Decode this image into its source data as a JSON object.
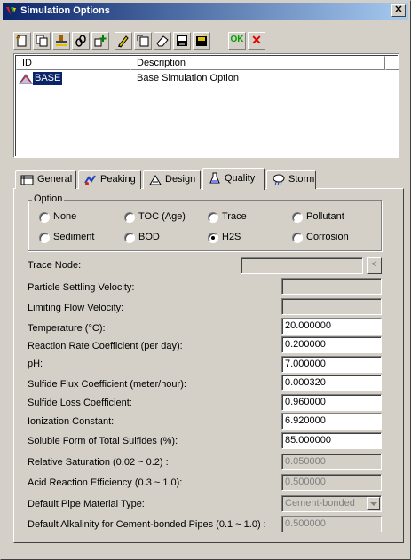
{
  "window": {
    "title": "Simulation Options",
    "close_glyph": "✕"
  },
  "toolbar": {
    "buttons": [
      {
        "name": "new-icon"
      },
      {
        "name": "copy-icon"
      },
      {
        "name": "stamp-icon"
      },
      {
        "name": "link-icon"
      },
      {
        "name": "add-icon"
      },
      {
        "name": "edit-icon"
      },
      {
        "name": "rename-icon"
      },
      {
        "name": "eraser-icon"
      },
      {
        "name": "save-icon"
      },
      {
        "name": "save-all-icon"
      }
    ],
    "ok_label": "OK",
    "cancel_glyph": "✕"
  },
  "list": {
    "columns": [
      "ID",
      "Description"
    ],
    "rows": [
      {
        "id": "BASE",
        "description": "Base Simulation Option"
      }
    ]
  },
  "tabs": [
    {
      "label": "General",
      "icon": "book-icon"
    },
    {
      "label": "Peaking",
      "icon": "peaking-icon"
    },
    {
      "label": "Design",
      "icon": "design-icon"
    },
    {
      "label": "Quality",
      "icon": "flask-icon"
    },
    {
      "label": "Storm",
      "icon": "storm-icon"
    }
  ],
  "active_tab": "Quality",
  "option": {
    "title": "Option",
    "choices": [
      "None",
      "TOC (Age)",
      "Trace",
      "Pollutant",
      "Sediment",
      "BOD",
      "H2S",
      "Corrosion"
    ],
    "selected": "H2S"
  },
  "fields": {
    "trace_node": {
      "label": "Trace Node:",
      "value": "",
      "browse": "<"
    },
    "settling_velocity": {
      "label": "Particle Settling Velocity:",
      "value": ""
    },
    "limiting_flow": {
      "label": "Limiting Flow Velocity:",
      "value": ""
    },
    "temperature": {
      "label": "Temperature (°C):",
      "value": "20.000000"
    },
    "reaction_rate": {
      "label": "Reaction Rate Coefficient (per day):",
      "value": "0.200000"
    },
    "ph": {
      "label": "pH:",
      "value": "7.000000"
    },
    "sulfide_flux": {
      "label": "Sulfide Flux Coefficient (meter/hour):",
      "value": "0.000320"
    },
    "sulfide_loss": {
      "label": "Sulfide Loss Coefficient:",
      "value": "0.960000"
    },
    "ionization": {
      "label": "Ionization Constant:",
      "value": "6.920000"
    },
    "soluble_form": {
      "label": "Soluble Form of Total Sulfides (%):",
      "value": "85.000000"
    },
    "relative_saturation": {
      "label": "Relative Saturation (0.02 ~ 0.2) :",
      "value": "0.050000"
    },
    "acid_reaction": {
      "label": "Acid Reaction Efficiency (0.3 ~ 1.0):",
      "value": "0.500000"
    },
    "pipe_material": {
      "label": "Default Pipe Material Type:",
      "value": "Cement-bonded"
    },
    "alkalinity": {
      "label": "Default Alkalinity for Cement-bonded Pipes (0.1 ~ 1.0) :",
      "value": "0.500000"
    }
  }
}
